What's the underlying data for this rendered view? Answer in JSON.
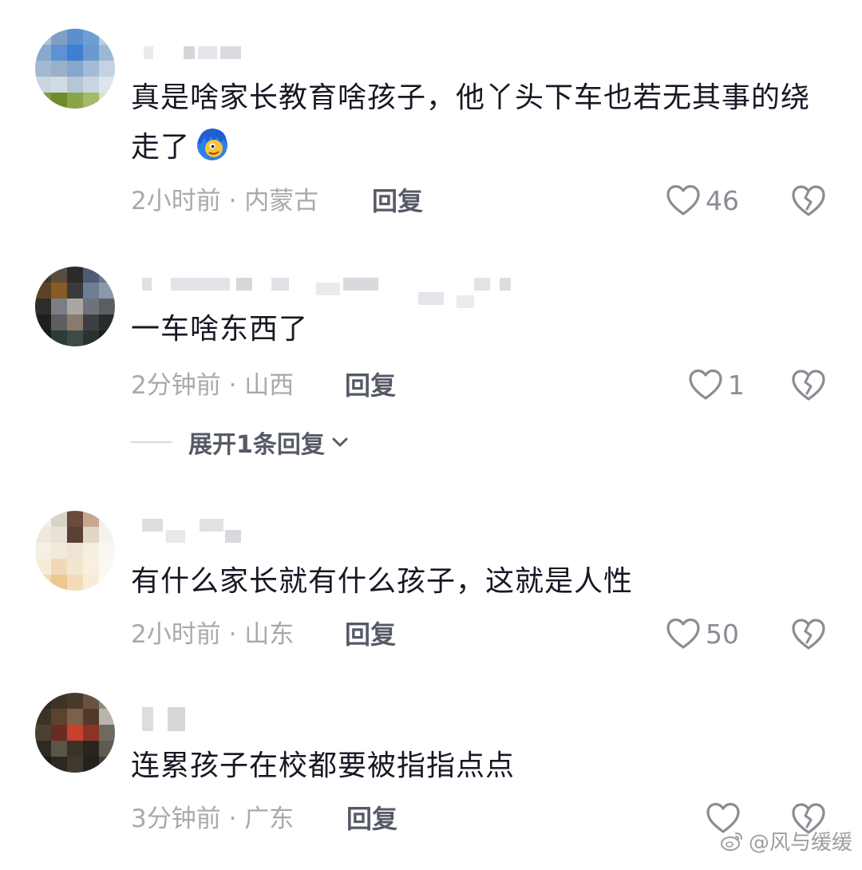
{
  "comments": [
    {
      "text": "真是啥家长教育啥孩子，他丫头下车也若无其事的绕走了",
      "time": "2小时前",
      "location": "内蒙古",
      "reply_label": "回复",
      "likes": "46",
      "emoji_icon": "blue-hair-face-emoji-icon"
    },
    {
      "text": "一车啥东西了",
      "time": "2分钟前",
      "location": "山西",
      "reply_label": "回复",
      "likes": "1",
      "expand_label": "展开1条回复"
    },
    {
      "text": "有什么家长就有什么孩子，这就是人性",
      "time": "2小时前",
      "location": "山东",
      "reply_label": "回复",
      "likes": "50"
    },
    {
      "text": "连累孩子在校都要被指指点点",
      "time": "3分钟前",
      "location": "广东",
      "reply_label": "回复",
      "likes": ""
    }
  ],
  "separator": " · ",
  "watermark": "@风与缓缓",
  "colors": {
    "text": "#161823",
    "meta": "#a7a9ad",
    "reply": "#565a66",
    "icon": "#8a8d94"
  }
}
